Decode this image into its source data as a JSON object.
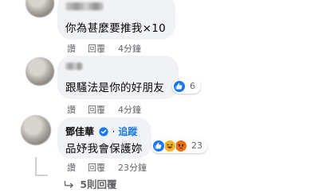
{
  "comments": [
    {
      "text": "你為甚麼要推我×10",
      "actions": {
        "like": "讚",
        "reply": "回覆",
        "time": "4分鐘"
      }
    },
    {
      "text": "跟騷法是你的好朋友",
      "reaction_count": "6",
      "actions": {
        "like": "讚",
        "reply": "回覆",
        "time": "4分鐘"
      }
    },
    {
      "author": "鄧佳華",
      "verified": true,
      "follow_label": "追蹤",
      "separator": "·",
      "text": "品妤我會保護妳",
      "reaction_count": "23",
      "actions": {
        "like": "讚",
        "reply": "回覆",
        "time": "23分鐘"
      }
    }
  ],
  "view_replies": "5則回覆",
  "colors": {
    "facebook_blue": "#1877f2",
    "like_blue": "#1877f2",
    "haha_yellow": "#f7b125",
    "angry_red": "#e9710f"
  },
  "icons": [
    "like-icon",
    "haha-icon",
    "angry-icon",
    "verified-badge-icon",
    "reply-arrow-icon"
  ]
}
